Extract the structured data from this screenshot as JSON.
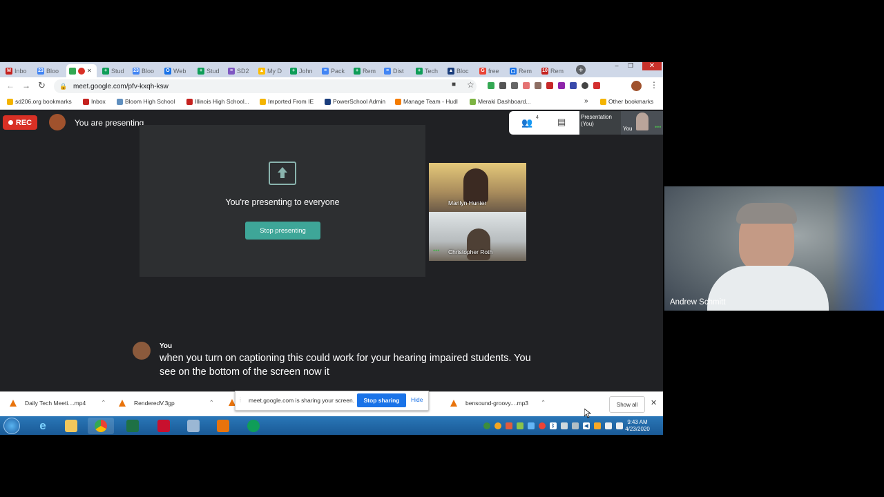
{
  "browser": {
    "tabs": [
      {
        "label": "Inbo",
        "color": "#c5221f",
        "glyph": "M"
      },
      {
        "label": "Bloo",
        "color": "#4285f4",
        "glyph": "23"
      },
      {
        "label": "",
        "color": "#34a853",
        "glyph": ""
      },
      {
        "label": "Stud",
        "color": "#0f9d58",
        "glyph": "+"
      },
      {
        "label": "Bloo",
        "color": "#4285f4",
        "glyph": "23"
      },
      {
        "label": "Web",
        "color": "#1a73e8",
        "glyph": "O"
      },
      {
        "label": "Stud",
        "color": "#0f9d58",
        "glyph": "+"
      },
      {
        "label": "SD2",
        "color": "#7e57c2",
        "glyph": "≡"
      },
      {
        "label": "My D",
        "color": "#fbbc04",
        "glyph": "▲"
      },
      {
        "label": "John",
        "color": "#0f9d58",
        "glyph": "+"
      },
      {
        "label": "Pack",
        "color": "#4285f4",
        "glyph": "≡"
      },
      {
        "label": "Rem",
        "color": "#0f9d58",
        "glyph": "+"
      },
      {
        "label": "Dist",
        "color": "#4285f4",
        "glyph": "≡"
      },
      {
        "label": "Tech",
        "color": "#0f9d58",
        "glyph": "+"
      },
      {
        "label": "Bloc",
        "color": "#1a3d7c",
        "glyph": "▲"
      },
      {
        "label": "free",
        "color": "#ea4335",
        "glyph": "G"
      },
      {
        "label": "Rem",
        "color": "#1a73e8",
        "glyph": "▢"
      },
      {
        "label": "Rem",
        "color": "#c5221f",
        "glyph": "10"
      }
    ],
    "url": "meet.google.com/pfv-kxqh-ksw",
    "bookmarks": [
      {
        "label": "sd206.org bookmarks",
        "color": "#f4b400"
      },
      {
        "label": "Inbox",
        "color": "#c5221f"
      },
      {
        "label": "Bloom High School",
        "color": "#5f8fbf"
      },
      {
        "label": "Illinois High School...",
        "color": "#c5221f"
      },
      {
        "label": "Imported From IE",
        "color": "#f4b400"
      },
      {
        "label": "PowerSchool Admin",
        "color": "#1a3d7c"
      },
      {
        "label": "Manage Team - Hudl",
        "color": "#f57c00"
      },
      {
        "label": "Meraki Dashboard...",
        "color": "#7cb342"
      }
    ],
    "overflow_chevron": "»",
    "other_bookmarks": "Other bookmarks"
  },
  "meet": {
    "rec_label": "REC",
    "presenting_status": "You are presenting",
    "participant_count": "4",
    "thumb_presentation": "Presentation (You)",
    "thumb_you": "You",
    "presenting_message": "You're presenting to everyone",
    "stop_presenting": "Stop presenting",
    "participants": [
      {
        "name": "Marilyn Hunter"
      },
      {
        "name": "Christopher Roth"
      }
    ],
    "caption": {
      "speaker": "You",
      "text": "when you turn on captioning this could work for your hearing impaired students. You see on the bottom of the screen now it"
    }
  },
  "downloads": {
    "items": [
      "Daily Tech Meeti....mp4",
      "RenderedV.3gp",
      "bensound-groovy....mp3"
    ],
    "show_all": "Show all"
  },
  "share_notice": {
    "text": "meet.google.com is sharing your screen.",
    "stop_label": "Stop sharing",
    "hide_label": "Hide"
  },
  "taskbar": {
    "time": "9:43 AM",
    "date": "4/23/2020"
  },
  "side_video": {
    "name": "Andrew Schmitt"
  }
}
